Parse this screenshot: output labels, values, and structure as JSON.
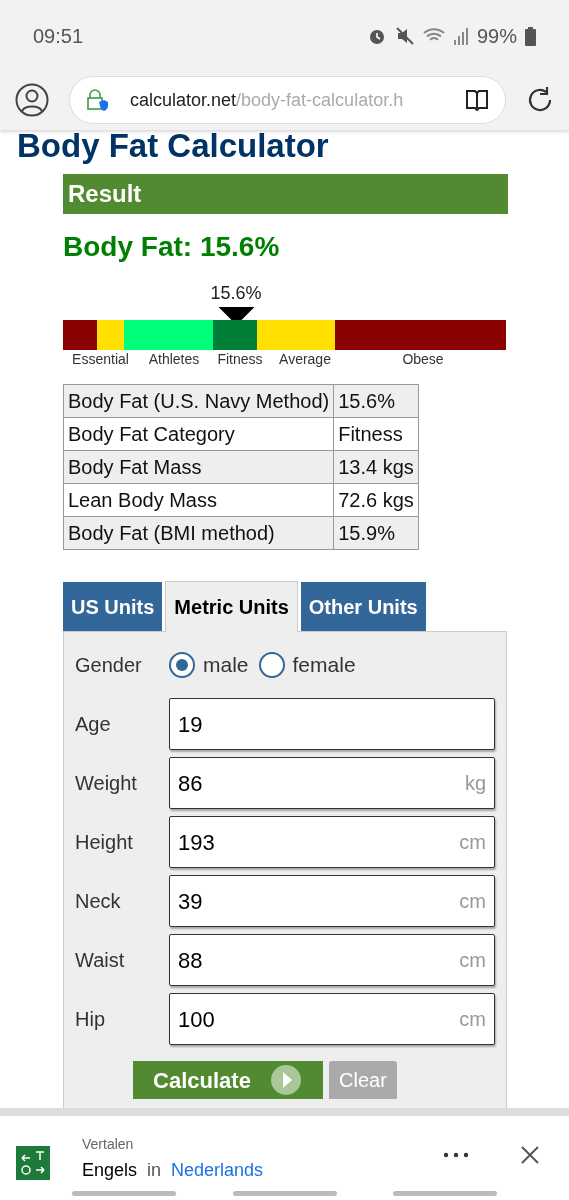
{
  "status_bar": {
    "time": "09:51",
    "battery": "99%"
  },
  "browser": {
    "url_host": "calculator.net",
    "url_path": "/body-fat-calculator.h"
  },
  "page_title": "Body Fat Calculator",
  "result": {
    "heading": "Result",
    "summary": "Body Fat: 15.6%",
    "gauge": {
      "reading": "15.6%",
      "bands": [
        {
          "color": "#8b0000"
        },
        {
          "color": "#ffe000"
        },
        {
          "color": "#00ff78"
        },
        {
          "color": "#008037"
        },
        {
          "color": "#ffe000"
        },
        {
          "color": "#8b0000"
        }
      ],
      "labels": [
        "Essential",
        "Athletes",
        "Fitness",
        "Average",
        "Obese"
      ]
    },
    "table": [
      [
        "Body Fat (U.S. Navy Method)",
        "15.6%"
      ],
      [
        "Body Fat Category",
        "Fitness"
      ],
      [
        "Body Fat Mass",
        "13.4 kgs"
      ],
      [
        "Lean Body Mass",
        "72.6 kgs"
      ],
      [
        "Body Fat (BMI method)",
        "15.9%"
      ]
    ]
  },
  "tabs": [
    {
      "label": "US Units",
      "selected": false
    },
    {
      "label": "Metric Units",
      "selected": true
    },
    {
      "label": "Other Units",
      "selected": false
    }
  ],
  "form": [
    {
      "kind": "radio",
      "label": "Gender",
      "options": [
        {
          "label": "male",
          "selected": true
        },
        {
          "label": "female",
          "selected": false
        }
      ]
    },
    {
      "kind": "field",
      "label": "Age",
      "value": "19"
    },
    {
      "kind": "field",
      "label": "Weight",
      "value": "86",
      "unit": "kg"
    },
    {
      "kind": "field",
      "label": "Height",
      "value": "193",
      "unit": "cm"
    },
    {
      "kind": "field",
      "label": "Neck",
      "value": "39",
      "unit": "cm"
    },
    {
      "kind": "field",
      "label": "Waist",
      "value": "88",
      "unit": "cm"
    },
    {
      "kind": "field",
      "label": "Hip",
      "value": "100",
      "unit": "cm"
    }
  ],
  "buttons": {
    "calculate": "Calculate",
    "clear": "Clear"
  },
  "translate_bar": {
    "title": "Vertalen",
    "source": "Engels",
    "joiner": "in",
    "target": "Nederlands"
  }
}
